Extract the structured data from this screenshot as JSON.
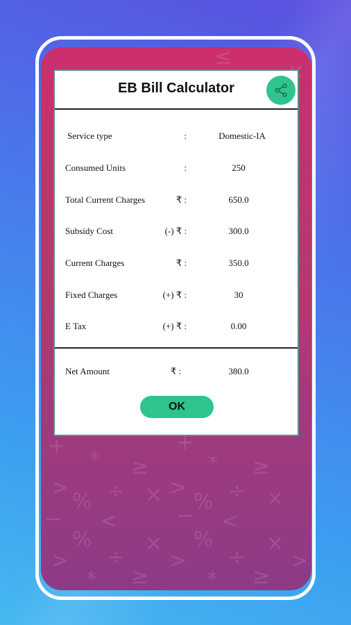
{
  "dialog": {
    "title": "EB Bill Calculator",
    "share_icon": "share-icon",
    "rows": [
      {
        "label": "Service type",
        "sep": ":",
        "value": "Domestic-IA"
      },
      {
        "label": "Consumed Units",
        "sep": ":",
        "value": "250"
      },
      {
        "label": "Total Current Charges",
        "sep": "₹ :",
        "value": "650.0"
      },
      {
        "label": "Subsidy Cost",
        "sep": "(-) ₹ :",
        "value": "300.0"
      },
      {
        "label": "Current Charges",
        "sep": "₹ :",
        "value": "350.0"
      },
      {
        "label": "Fixed Charges",
        "sep": "(+) ₹ :",
        "value": "30"
      },
      {
        "label": "E Tax",
        "sep": "(+) ₹ :",
        "value": "0.00"
      }
    ],
    "net": {
      "label": "Net Amount",
      "sep": "₹ :",
      "value": "380.0"
    },
    "ok_label": "OK"
  },
  "colors": {
    "accent": "#2fc48d",
    "screen_top": "#cc2f6d",
    "screen_bottom": "#8e3a86",
    "background": "#4b74ea"
  }
}
